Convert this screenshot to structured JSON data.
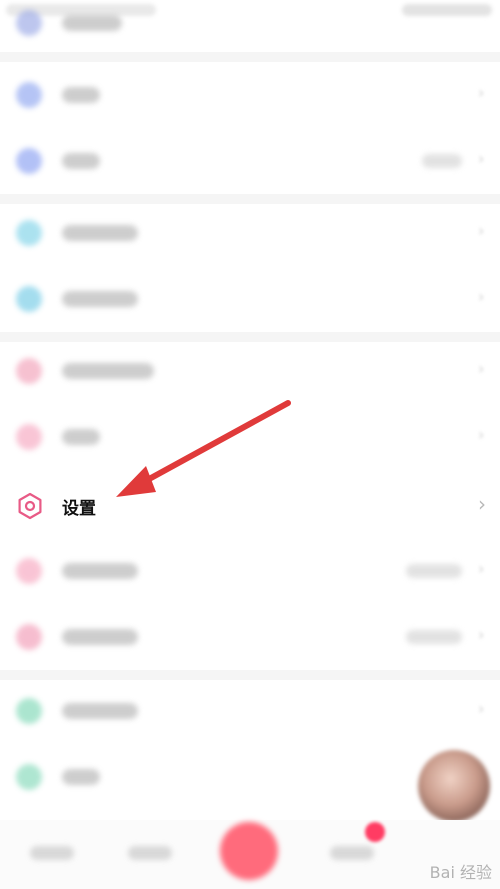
{
  "settings_row": {
    "label": "设置",
    "chevron": "›"
  },
  "watermark": {
    "text": "Bai 经验"
  },
  "icons": {
    "settings": "settings-hexagon-icon",
    "chevron": "chevron-right-icon",
    "arrow": "annotation-arrow"
  },
  "colors": {
    "settings_icon": "#e85a86",
    "arrow": "#e03a3a",
    "center_button": "#ff6b7c",
    "badge": "#ff3c63"
  }
}
